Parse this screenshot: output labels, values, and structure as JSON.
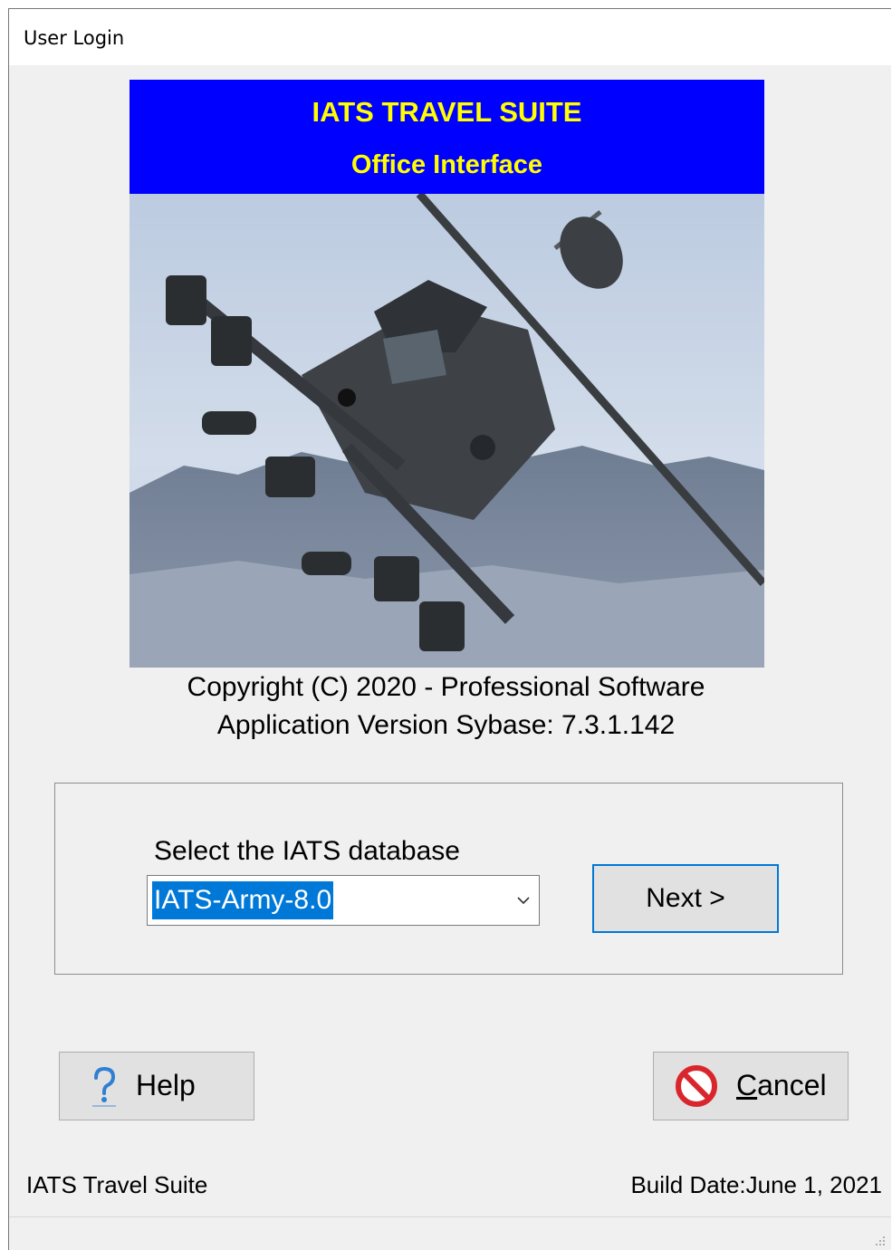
{
  "window": {
    "title": "User Login"
  },
  "banner": {
    "title": "IATS TRAVEL SUITE",
    "subtitle": "Office Interface",
    "bg_color": "#0000ff",
    "text_color": "#ffff00"
  },
  "splash_image": {
    "icon": "attack-helicopter-photo"
  },
  "info": {
    "copyright": "Copyright (C) 2020 - Professional Software",
    "version": "Application Version Sybase: 7.3.1.142"
  },
  "database": {
    "label": "Select the IATS database",
    "selected": "IATS-Army-8.0",
    "selection_color": "#0078d7"
  },
  "buttons": {
    "next": "Next >",
    "help": "Help",
    "cancel": "Cancel",
    "help_icon": "question-mark-icon",
    "cancel_icon": "no-entry-icon"
  },
  "status": {
    "left": "IATS Travel Suite",
    "right": "Build Date:June 1, 2021"
  }
}
